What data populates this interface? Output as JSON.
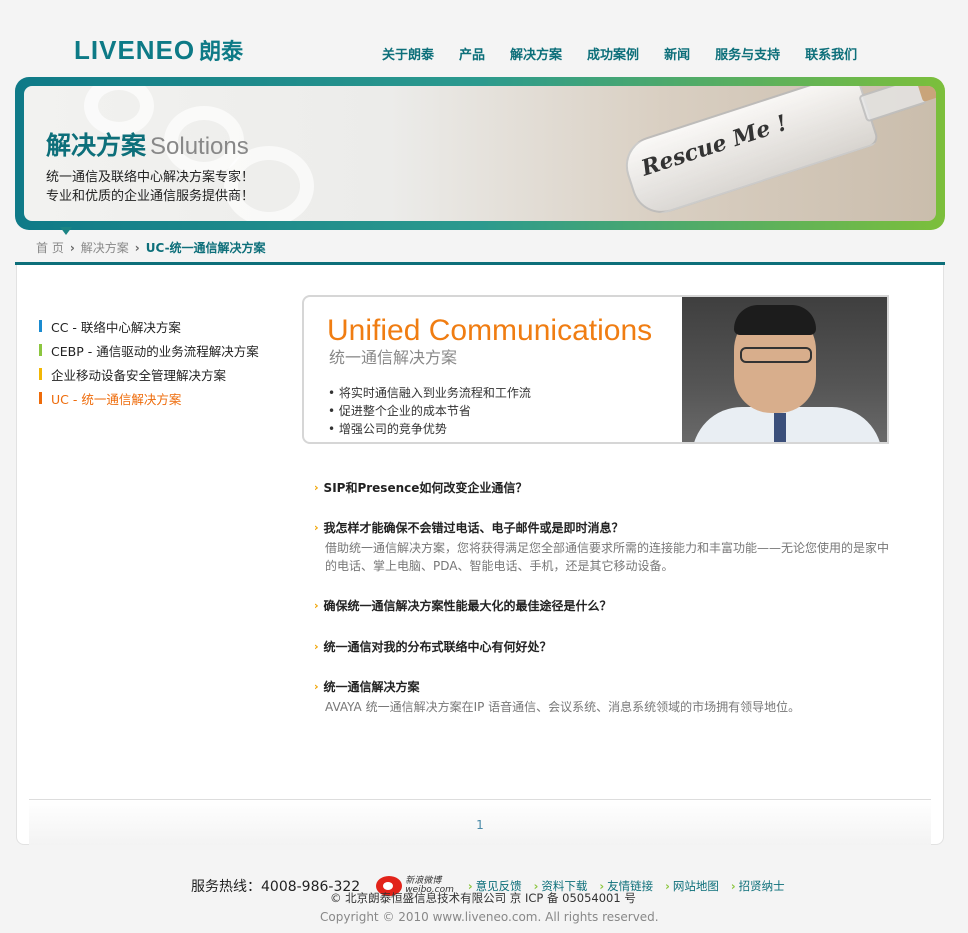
{
  "header": {
    "logo_text": "LIVENEO",
    "logo_cn": "朗泰",
    "nav": [
      "关于朗泰",
      "产品",
      "解决方案",
      "成功案例",
      "新闻",
      "服务与支持",
      "联系我们"
    ]
  },
  "banner": {
    "title_cn": "解决方案",
    "title_en": "Solutions",
    "line1": "统一通信及联络中心解决方案专家！",
    "line2": "专业和优质的企业通信服务提供商！",
    "bottle_text": "Rescue Me !"
  },
  "breadcrumb": {
    "home": "首 页",
    "section": "解决方案",
    "current": "UC-统一通信解决方案"
  },
  "side_menu": [
    {
      "label": "CC - 联络中心解决方案",
      "color": "#1a8bd0",
      "active": false
    },
    {
      "label": "CEBP - 通信驱动的业务流程解决方案",
      "color": "#8cc63f",
      "active": false
    },
    {
      "label": "企业移动设备安全管理解决方案",
      "color": "#f2b705",
      "active": false
    },
    {
      "label": "UC - 统一通信解决方案",
      "color": "#ee6b0a",
      "active": true
    }
  ],
  "intro": {
    "title_en": "Unified Communications",
    "title_cn": "统一通信解决方案",
    "bullets": [
      "• 将实时通信融入到业务流程和工作流",
      "• 促进整个企业的成本节省",
      "• 增强公司的竞争优势"
    ]
  },
  "qa": [
    {
      "q": "SIP和Presence如何改变企业通信？",
      "a": ""
    },
    {
      "q": "我怎样才能确保不会错过电话、电子邮件或是即时消息？",
      "a": "借助统一通信解决方案，您将获得满足您全部通信要求所需的连接能力和丰富功能——无论您使用的是家中的电话、掌上电脑、PDA、智能电话、手机，还是其它移动设备。"
    },
    {
      "q": "确保统一通信解决方案性能最大化的最佳途径是什么？",
      "a": ""
    },
    {
      "q": "统一通信对我的分布式联络中心有何好处？",
      "a": ""
    },
    {
      "q": "统一通信解决方案",
      "a": "AVAYA 统一通信解决方案在IP 语音通信、会议系统、消息系统领域的市场拥有领导地位。"
    }
  ],
  "pagination": {
    "page": "1"
  },
  "footer": {
    "hotline_label": "服务热线：",
    "hotline_number": "4008-986-322",
    "weibo_line1": "新浪微博",
    "weibo_line2": "weibo.com",
    "links": [
      "意见反馈",
      "资料下载",
      "友情链接",
      "网站地图",
      "招贤纳士"
    ],
    "company": "© 北京朗泰恒盛信息技术有限公司   京 ICP 备 05054001 号",
    "copyright": "Copyright © 2010 www.liveneo.com. All rights reserved."
  }
}
